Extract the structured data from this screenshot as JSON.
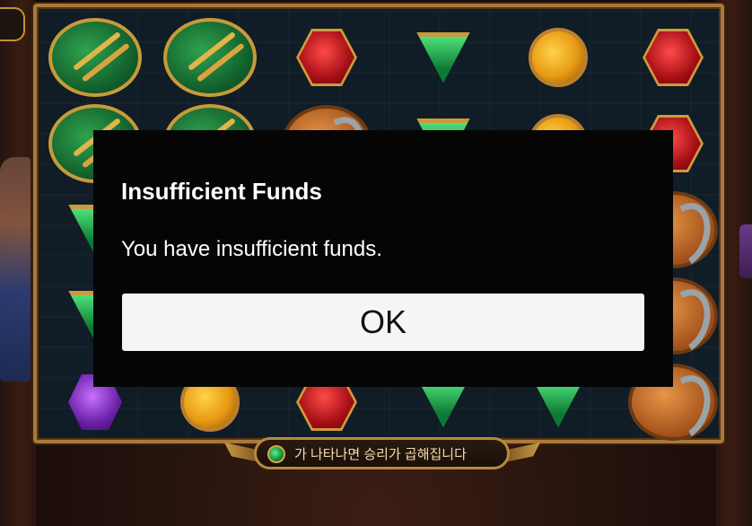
{
  "dialog": {
    "title": "Insufficient Funds",
    "message": "You have insufficient funds.",
    "ok_label": "OK"
  },
  "game": {
    "banner_text": "가 나타나면 승리가 곱해집니다",
    "symbols": [
      {
        "type": "bow-icon"
      },
      {
        "type": "bow-icon"
      },
      {
        "type": "red-gem-icon"
      },
      {
        "type": "green-triangle-gem-icon"
      },
      {
        "type": "yellow-gem-icon"
      },
      {
        "type": "red-gem-icon"
      },
      {
        "type": "bow-icon"
      },
      {
        "type": "bow-icon"
      },
      {
        "type": "axe-icon"
      },
      {
        "type": "green-triangle-gem-icon"
      },
      {
        "type": "yellow-gem-icon"
      },
      {
        "type": "red-gem-icon"
      },
      {
        "type": "purple-gem-icon"
      },
      {
        "type": "yellow-gem-icon"
      },
      {
        "type": "red-gem-icon"
      },
      {
        "type": "green-triangle-gem-icon"
      },
      {
        "type": "green-triangle-gem-icon"
      },
      {
        "type": "axe-icon"
      }
    ]
  },
  "colors": {
    "dialog_bg": "#050505",
    "button_bg": "#f5f5f5",
    "frame_gold": "#a87a3a"
  }
}
